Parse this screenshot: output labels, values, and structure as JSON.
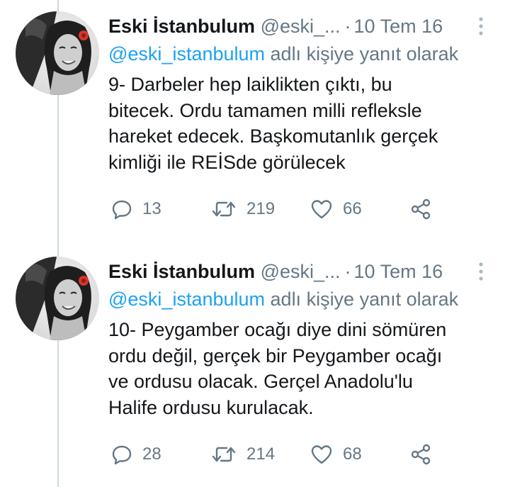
{
  "tweets": [
    {
      "author": "Eski İstanbulum",
      "handle": "@eski_...",
      "separator": "·",
      "date": "10 Tem 16",
      "reply_to": "@eski_istanbulum",
      "reply_suffix": "adlı kişiye yanıt olarak",
      "lines": [
        "9- Darbeler hep laiklikten çıktı, bu",
        "bitecek. Ordu tamamen milli refleksle",
        "hareket edecek. Başkomutanlık gerçek",
        "kimliği ile REİSde görülecek"
      ],
      "replies": "13",
      "retweets": "219",
      "likes": "66"
    },
    {
      "author": "Eski İstanbulum",
      "handle": "@eski_...",
      "separator": "·",
      "date": "10 Tem 16",
      "reply_to": "@eski_istanbulum",
      "reply_suffix": "adlı kişiye yanıt olarak",
      "lines": [
        "10- Peygamber ocağı diye dini sömüren",
        "ordu değil, gerçek bir Peygamber ocağı",
        "ve ordusu olacak. Gerçel Anadolu'lu",
        "Halife ordusu kurulacak."
      ],
      "replies": "28",
      "retweets": "214",
      "likes": "68"
    }
  ],
  "icons": {
    "reply": "reply-icon",
    "retweet": "retweet-icon",
    "like": "heart-icon",
    "share": "share-icon",
    "more": "more-vertical-icon"
  },
  "colors": {
    "name": "#14171a",
    "secondary": "#657786",
    "mention": "#1da1f2",
    "thread_line": "#cfd9de",
    "avatar_flower": "#d9342b"
  }
}
